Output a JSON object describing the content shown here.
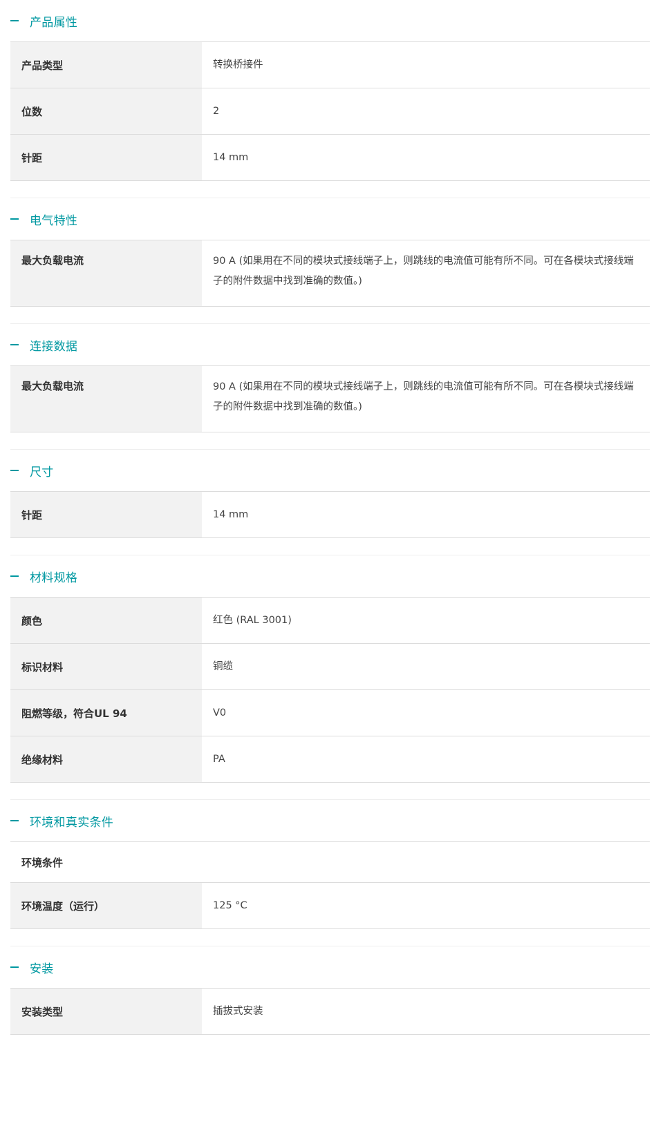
{
  "sections": [
    {
      "title": "产品属性",
      "rows": [
        {
          "label": "产品类型",
          "value": "转换桥接件"
        },
        {
          "label": "位数",
          "value": "2"
        },
        {
          "label": "针距",
          "value": "14 mm"
        }
      ]
    },
    {
      "title": "电气特性",
      "rows": [
        {
          "label": "最大负载电流",
          "value": "90 A (如果用在不同的模块式接线端子上，则跳线的电流值可能有所不同。可在各模块式接线端子的附件数据中找到准确的数值。)"
        }
      ]
    },
    {
      "title": "连接数据",
      "rows": [
        {
          "label": "最大负载电流",
          "value": "90 A (如果用在不同的模块式接线端子上，则跳线的电流值可能有所不同。可在各模块式接线端子的附件数据中找到准确的数值。)"
        }
      ]
    },
    {
      "title": "尺寸",
      "rows": [
        {
          "label": "针距",
          "value": "14 mm"
        }
      ]
    },
    {
      "title": "材料规格",
      "rows": [
        {
          "label": "颜色",
          "value": "红色 (RAL 3001)"
        },
        {
          "label": "标识材料",
          "value": "铜缆"
        },
        {
          "label": "阻燃等级，符合UL 94",
          "value": "V0"
        },
        {
          "label": "绝缘材料",
          "value": "PA"
        }
      ]
    },
    {
      "title": "环境和真实条件",
      "rows": [
        {
          "label": "环境条件",
          "value": ""
        },
        {
          "label": "环境温度（运行）",
          "value": "125 °C"
        }
      ]
    },
    {
      "title": "安装",
      "rows": [
        {
          "label": "安装类型",
          "value": "插拔式安装"
        }
      ]
    }
  ],
  "theme": {
    "accent": "#0098a1",
    "label_bg": "#f2f2f2",
    "border": "#dcdcdc"
  }
}
